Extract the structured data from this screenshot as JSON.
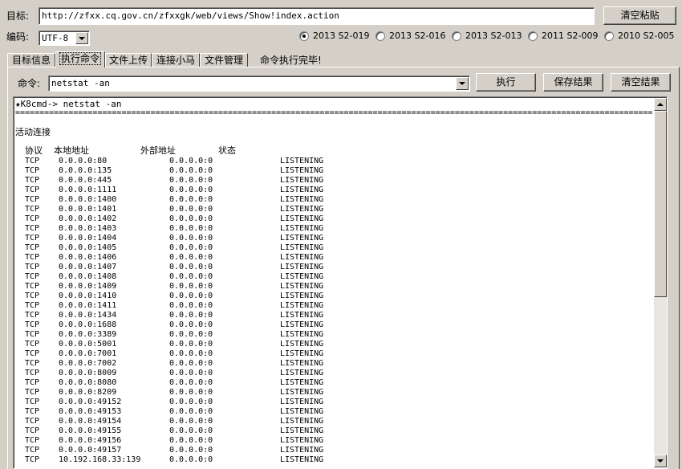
{
  "target": {
    "label": "目标:",
    "url": "http://zfxx.cq.gov.cn/zfxxgk/web/views/Show!index.action"
  },
  "clear_paste_button": "清空粘贴",
  "encoding": {
    "label": "编码:",
    "value": "UTF-8"
  },
  "exploits": [
    {
      "label": "2013 S2-019",
      "selected": true
    },
    {
      "label": "2013 S2-016",
      "selected": false
    },
    {
      "label": "2013 S2-013",
      "selected": false
    },
    {
      "label": "2011 S2-009",
      "selected": false
    },
    {
      "label": "2010 S2-005",
      "selected": false
    }
  ],
  "tabs": [
    {
      "label": "目标信息",
      "active": false
    },
    {
      "label": "执行命令",
      "active": true
    },
    {
      "label": "文件上传",
      "active": false
    },
    {
      "label": "连接小马",
      "active": false
    },
    {
      "label": "文件管理",
      "active": false
    }
  ],
  "status_text": "命令执行完毕!",
  "command": {
    "label": "命令:",
    "value": "netstat -an"
  },
  "buttons": {
    "execute": "执行",
    "save_result": "保存结果",
    "clear_result": "清空结果"
  },
  "output": {
    "prompt": "★K8cmd-> netstat -an",
    "separator": "=====================================================================================================================================",
    "section_title": "活动连接",
    "headers": {
      "proto": "协议",
      "local": "本地地址",
      "foreign": "外部地址",
      "state": "状态"
    },
    "rows": [
      {
        "proto": "TCP",
        "local": "0.0.0.0:80",
        "foreign": "0.0.0.0:0",
        "state": "LISTENING"
      },
      {
        "proto": "TCP",
        "local": "0.0.0.0:135",
        "foreign": "0.0.0.0:0",
        "state": "LISTENING"
      },
      {
        "proto": "TCP",
        "local": "0.0.0.0:445",
        "foreign": "0.0.0.0:0",
        "state": "LISTENING"
      },
      {
        "proto": "TCP",
        "local": "0.0.0.0:1111",
        "foreign": "0.0.0.0:0",
        "state": "LISTENING"
      },
      {
        "proto": "TCP",
        "local": "0.0.0.0:1400",
        "foreign": "0.0.0.0:0",
        "state": "LISTENING"
      },
      {
        "proto": "TCP",
        "local": "0.0.0.0:1401",
        "foreign": "0.0.0.0:0",
        "state": "LISTENING"
      },
      {
        "proto": "TCP",
        "local": "0.0.0.0:1402",
        "foreign": "0.0.0.0:0",
        "state": "LISTENING"
      },
      {
        "proto": "TCP",
        "local": "0.0.0.0:1403",
        "foreign": "0.0.0.0:0",
        "state": "LISTENING"
      },
      {
        "proto": "TCP",
        "local": "0.0.0.0:1404",
        "foreign": "0.0.0.0:0",
        "state": "LISTENING"
      },
      {
        "proto": "TCP",
        "local": "0.0.0.0:1405",
        "foreign": "0.0.0.0:0",
        "state": "LISTENING"
      },
      {
        "proto": "TCP",
        "local": "0.0.0.0:1406",
        "foreign": "0.0.0.0:0",
        "state": "LISTENING"
      },
      {
        "proto": "TCP",
        "local": "0.0.0.0:1407",
        "foreign": "0.0.0.0:0",
        "state": "LISTENING"
      },
      {
        "proto": "TCP",
        "local": "0.0.0.0:1408",
        "foreign": "0.0.0.0:0",
        "state": "LISTENING"
      },
      {
        "proto": "TCP",
        "local": "0.0.0.0:1409",
        "foreign": "0.0.0.0:0",
        "state": "LISTENING"
      },
      {
        "proto": "TCP",
        "local": "0.0.0.0:1410",
        "foreign": "0.0.0.0:0",
        "state": "LISTENING"
      },
      {
        "proto": "TCP",
        "local": "0.0.0.0:1411",
        "foreign": "0.0.0.0:0",
        "state": "LISTENING"
      },
      {
        "proto": "TCP",
        "local": "0.0.0.0:1434",
        "foreign": "0.0.0.0:0",
        "state": "LISTENING"
      },
      {
        "proto": "TCP",
        "local": "0.0.0.0:1688",
        "foreign": "0.0.0.0:0",
        "state": "LISTENING"
      },
      {
        "proto": "TCP",
        "local": "0.0.0.0:3389",
        "foreign": "0.0.0.0:0",
        "state": "LISTENING"
      },
      {
        "proto": "TCP",
        "local": "0.0.0.0:5001",
        "foreign": "0.0.0.0:0",
        "state": "LISTENING"
      },
      {
        "proto": "TCP",
        "local": "0.0.0.0:7001",
        "foreign": "0.0.0.0:0",
        "state": "LISTENING"
      },
      {
        "proto": "TCP",
        "local": "0.0.0.0:7002",
        "foreign": "0.0.0.0:0",
        "state": "LISTENING"
      },
      {
        "proto": "TCP",
        "local": "0.0.0.0:8009",
        "foreign": "0.0.0.0:0",
        "state": "LISTENING"
      },
      {
        "proto": "TCP",
        "local": "0.0.0.0:8080",
        "foreign": "0.0.0.0:0",
        "state": "LISTENING"
      },
      {
        "proto": "TCP",
        "local": "0.0.0.0:8209",
        "foreign": "0.0.0.0:0",
        "state": "LISTENING"
      },
      {
        "proto": "TCP",
        "local": "0.0.0.0:49152",
        "foreign": "0.0.0.0:0",
        "state": "LISTENING"
      },
      {
        "proto": "TCP",
        "local": "0.0.0.0:49153",
        "foreign": "0.0.0.0:0",
        "state": "LISTENING"
      },
      {
        "proto": "TCP",
        "local": "0.0.0.0:49154",
        "foreign": "0.0.0.0:0",
        "state": "LISTENING"
      },
      {
        "proto": "TCP",
        "local": "0.0.0.0:49155",
        "foreign": "0.0.0.0:0",
        "state": "LISTENING"
      },
      {
        "proto": "TCP",
        "local": "0.0.0.0:49156",
        "foreign": "0.0.0.0:0",
        "state": "LISTENING"
      },
      {
        "proto": "TCP",
        "local": "0.0.0.0:49157",
        "foreign": "0.0.0.0:0",
        "state": "LISTENING"
      },
      {
        "proto": "TCP",
        "local": "10.192.168.33:139",
        "foreign": "0.0.0.0:0",
        "state": "LISTENING"
      }
    ]
  }
}
